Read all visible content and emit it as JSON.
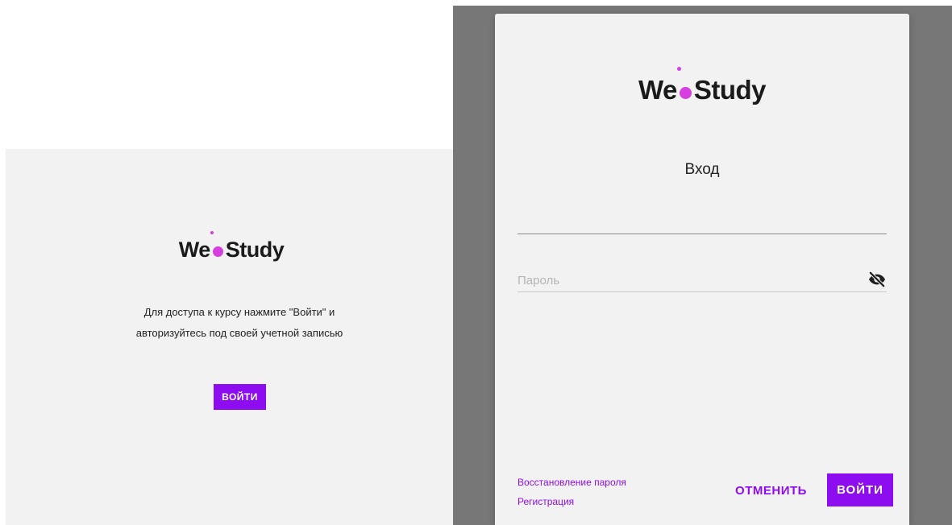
{
  "background": {
    "logo": {
      "part1": "We",
      "part2": "Study"
    },
    "description": "Для доступа к курсу нажмите \"Войти\" и авторизуйтесь под своей учетной записью",
    "login_button": "ВОЙТИ"
  },
  "dialog": {
    "logo": {
      "part1": "We",
      "part2": "Study"
    },
    "title": "Вход",
    "login_field": {
      "value": "",
      "placeholder": ""
    },
    "password_field": {
      "value": "",
      "placeholder": "Пароль",
      "toggle_icon": "eye-off-icon"
    },
    "links": {
      "recover_password": "Восстановление пароля",
      "register": "Регистрация"
    },
    "cancel_button": "ОТМЕНИТЬ",
    "submit_button": "ВОЙТИ"
  },
  "colors": {
    "accent": "#8e0cf0",
    "logo_dot": "#d63ee0",
    "overlay": "#777777",
    "panel": "#f2f2f2"
  }
}
